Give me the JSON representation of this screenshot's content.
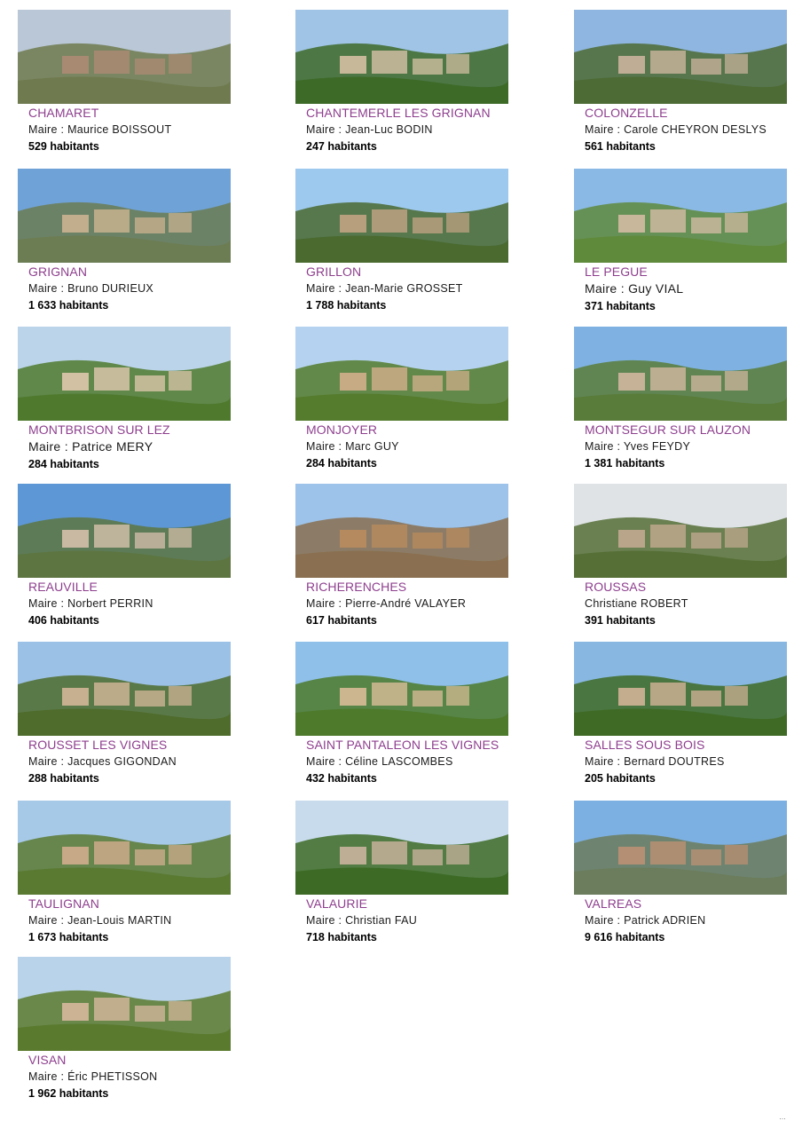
{
  "villages": [
    {
      "name": "CHAMARET",
      "mayor": "Maire : Maurice BOISSOUT",
      "pop": "529 habitants",
      "sky": "#b9c7d6",
      "land": "#6f7a4e",
      "roof": "#a88a73"
    },
    {
      "name": "CHANTEMERLE LES GRIGNAN",
      "mayor": "Maire : Jean-Luc BODIN",
      "pop": "247 habitants",
      "sky": "#9fc4e6",
      "land": "#3e6a28",
      "roof": "#c7b89a"
    },
    {
      "name": "COLONZELLE",
      "mayor": "Maire : Carole CHEYRON DESLYS",
      "pop": "561 habitants",
      "sky": "#8fb6e0",
      "land": "#4d6b34",
      "roof": "#bfae95"
    },
    {
      "name": "GRIGNAN",
      "mayor": "Maire : Bruno DURIEUX",
      "pop": "1 633 habitants",
      "sky": "#6fa3d8",
      "land": "#6c7d53",
      "roof": "#c2ae8c"
    },
    {
      "name": "GRILLON",
      "mayor": "Maire : Jean-Marie GROSSET",
      "pop": "1 788 habitants",
      "sky": "#9ec9ef",
      "land": "#4a6a30",
      "roof": "#b79f7e"
    },
    {
      "name": "LE PEGUE",
      "mayor": "Maire : Guy VIAL",
      "pop": "371 habitants",
      "sky": "#8ab9e6",
      "land": "#5f8a3c",
      "roof": "#c9b79c"
    },
    {
      "name": "MONTBRISON SUR LEZ",
      "mayor": "Maire : Patrice MERY",
      "pop": "284 habitants",
      "sky": "#bcd4ea",
      "land": "#4f7a2e",
      "roof": "#d2c1a3"
    },
    {
      "name": "MONJOYER",
      "mayor": "Maire : Marc GUY",
      "pop": "284 habitants",
      "sky": "#b5d3f0",
      "land": "#557b2d",
      "roof": "#c7ab85"
    },
    {
      "name": "MONTSEGUR SUR LAUZON",
      "mayor": "Maire : Yves FEYDY",
      "pop": "1 381 habitants",
      "sky": "#7fb2e3",
      "land": "#5a7c3a",
      "roof": "#c6b297"
    },
    {
      "name": "REAUVILLE",
      "mayor": "Maire : Norbert PERRIN",
      "pop": "406 habitants",
      "sky": "#5d97d6",
      "land": "#5d7540",
      "roof": "#c9b9a3"
    },
    {
      "name": "RICHERENCHES",
      "mayor": "Maire : Pierre-André VALAYER",
      "pop": "617 habitants",
      "sky": "#9dc3ea",
      "land": "#8a7050",
      "roof": "#b48a5e"
    },
    {
      "name": "ROUSSAS",
      "mayor": "Christiane ROBERT",
      "pop": "391 habitants",
      "sky": "#dfe3e6",
      "land": "#566f36",
      "roof": "#b9a58a"
    },
    {
      "name": "ROUSSET LES VIGNES",
      "mayor": "Maire : Jacques GIGONDAN",
      "pop": "288 habitants",
      "sky": "#9cc1e6",
      "land": "#4f6c2c",
      "roof": "#c7b090"
    },
    {
      "name": "SAINT PANTALEON LES VIGNES",
      "mayor": "Maire : Céline LASCOMBES",
      "pop": "432 habitants",
      "sky": "#8fc0ea",
      "land": "#4e7a2b",
      "roof": "#cbb68f"
    },
    {
      "name": "SALLES SOUS BOIS",
      "mayor": "Maire : Bernard DOUTRES",
      "pop": "205 habitants",
      "sky": "#88b8e2",
      "land": "#3f6a25",
      "roof": "#c4ad8e"
    },
    {
      "name": "TAULIGNAN",
      "mayor": "Maire : Jean-Louis MARTIN",
      "pop": "1 673 habitants",
      "sky": "#a7c9e8",
      "land": "#5a7a32",
      "roof": "#c7a987"
    },
    {
      "name": "VALAURIE",
      "mayor": "Maire : Christian FAU",
      "pop": "718 habitants",
      "sky": "#c8dbec",
      "land": "#3d6b26",
      "roof": "#bfae96"
    },
    {
      "name": "VALREAS",
      "mayor": "Maire : Patrick ADRIEN",
      "pop": "9 616 habitants",
      "sky": "#7db0e2",
      "land": "#6b7d5c",
      "roof": "#b58f73"
    },
    {
      "name": "VISAN",
      "mayor": "Maire : Éric PHETISSON",
      "pop": "1 962 habitants",
      "sky": "#b9d3ea",
      "land": "#5a7a2e",
      "roof": "#cbb394"
    }
  ],
  "footer": "…"
}
